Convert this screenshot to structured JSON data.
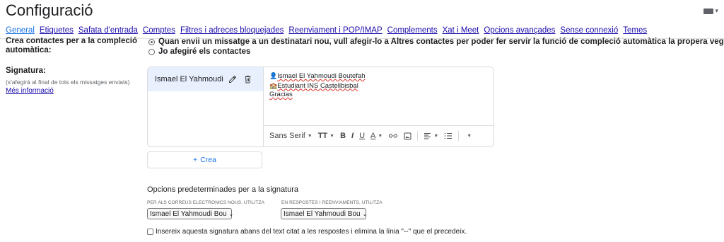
{
  "header": {
    "title": "Configuració",
    "keyboard_icon": "keyboard-icon"
  },
  "tabs": [
    {
      "label": "General",
      "active": true
    },
    {
      "label": "Etiquetes"
    },
    {
      "label": "Safata d'entrada"
    },
    {
      "label": "Comptes"
    },
    {
      "label": "Filtres i adreces bloquejades"
    },
    {
      "label": "Reenviament i POP/IMAP"
    },
    {
      "label": "Complements"
    },
    {
      "label": "Xat i Meet"
    },
    {
      "label": "Opcions avançades"
    },
    {
      "label": "Sense connexió"
    },
    {
      "label": "Temes"
    }
  ],
  "autocomplete": {
    "label": "Crea contactes per a la compleció automàtica:",
    "option_auto": "Quan envii un missatge a un destinatari nou, vull afegir-lo a Altres contactes per poder fer servir la funció de compleció automàtica la propera vegada",
    "option_manual": "Jo afegiré els contactes",
    "selected": "option_auto"
  },
  "signature": {
    "label": "Signatura:",
    "note": "(s'afegirà al final de tots els missatges enviats)",
    "more_link": "Més informació",
    "item_name": "Ismael El Yahmoudi B...",
    "editor_lines": [
      {
        "icon": "👤",
        "text": "Ismael El Yahmoudi Boutefah"
      },
      {
        "icon": "🏫",
        "text": "Estudiant INS Castellbisbal"
      },
      {
        "icon": "",
        "text": "Gracias"
      }
    ],
    "toolbar": {
      "font": "Sans Serif",
      "size_icon": "TT",
      "bold": "B",
      "italic": "I",
      "underline": "U",
      "text_color": "A"
    },
    "create_button": "Crea"
  },
  "defaults": {
    "title": "Opcions predeterminades per a la signatura",
    "new_caption": "PER ALS CORREUS ELECTRÒNICS NOUS, UTILITZA",
    "reply_caption": "EN RESPOSTES I REENVIAMENTS, UTILITZA",
    "new_value": "Ismael El Yahmoudi Bou",
    "reply_value": "Ismael El Yahmoudi Bou",
    "insert_before_quote": "Insereix aquesta signatura abans del text citat a les respostes i elimina la línia \"--\" que el precedeix.",
    "insert_before_checked": false
  },
  "colors": {
    "link": "#1a0dab",
    "accent": "#1a73e8",
    "selected_bg": "#e8f0fe"
  }
}
